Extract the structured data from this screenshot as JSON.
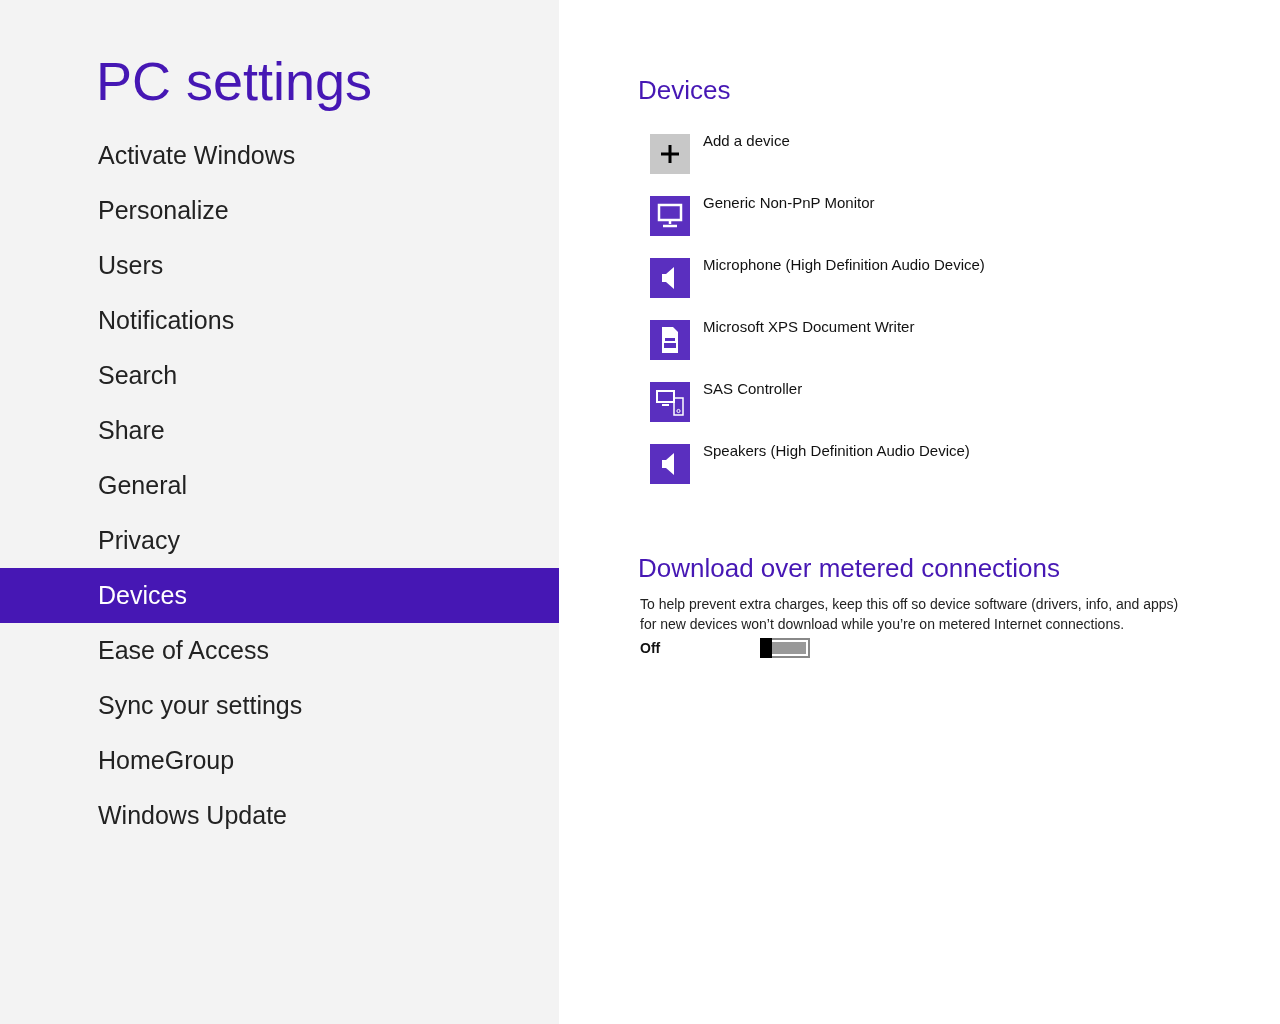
{
  "sidebar": {
    "title": "PC settings",
    "items": [
      {
        "label": "Activate Windows",
        "selected": false
      },
      {
        "label": "Personalize",
        "selected": false
      },
      {
        "label": "Users",
        "selected": false
      },
      {
        "label": "Notifications",
        "selected": false
      },
      {
        "label": "Search",
        "selected": false
      },
      {
        "label": "Share",
        "selected": false
      },
      {
        "label": "General",
        "selected": false
      },
      {
        "label": "Privacy",
        "selected": false
      },
      {
        "label": "Devices",
        "selected": true
      },
      {
        "label": "Ease of Access",
        "selected": false
      },
      {
        "label": "Sync your settings",
        "selected": false
      },
      {
        "label": "HomeGroup",
        "selected": false
      },
      {
        "label": "Windows Update",
        "selected": false
      }
    ]
  },
  "devices": {
    "heading": "Devices",
    "items": [
      {
        "kind": "add",
        "label": "Add a device"
      },
      {
        "kind": "monitor",
        "label": "Generic Non-PnP Monitor"
      },
      {
        "kind": "speaker",
        "label": "Microphone (High Definition Audio Device)"
      },
      {
        "kind": "printer",
        "label": "Microsoft XPS Document Writer"
      },
      {
        "kind": "multi",
        "label": "SAS Controller"
      },
      {
        "kind": "speaker",
        "label": "Speakers (High Definition Audio Device)"
      }
    ]
  },
  "metered": {
    "heading": "Download over metered connections",
    "description": "To help prevent extra charges, keep this off so device software (drivers, info, and apps) for new devices won’t download while you’re on metered Internet connections.",
    "toggle": {
      "label": "Off",
      "on": false
    }
  }
}
